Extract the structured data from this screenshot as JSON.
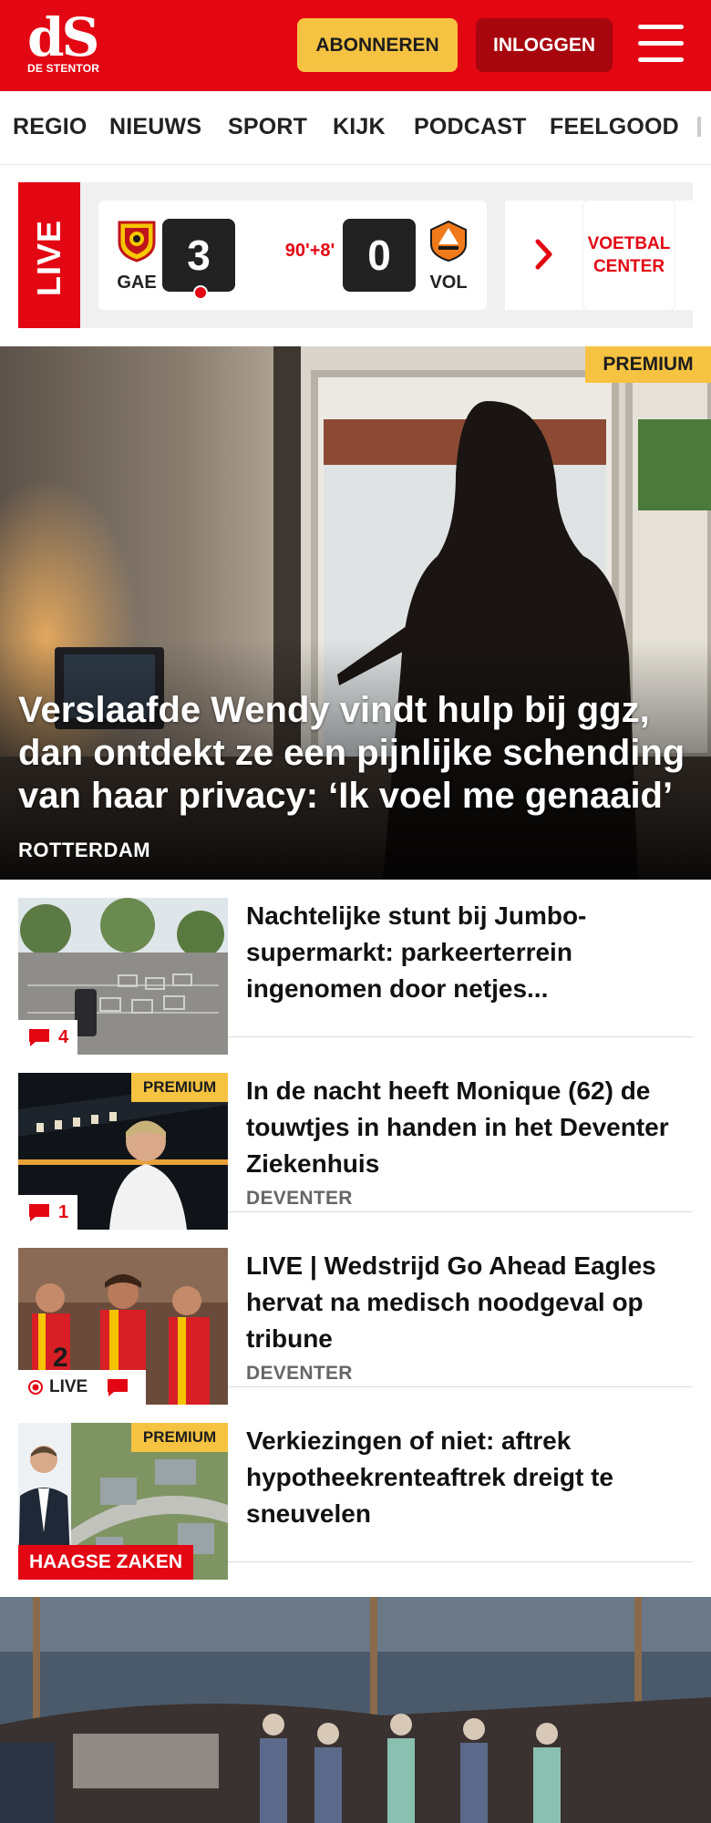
{
  "header": {
    "logo_mark": "dS",
    "logo_sub": "DE STENTOR",
    "subscribe_label": "ABONNEREN",
    "login_label": "INLOGGEN",
    "brand_color": "#e30613",
    "accent_color": "#f5c242"
  },
  "nav": {
    "items": [
      "REGIO",
      "NIEUWS",
      "SPORT",
      "KIJK",
      "PODCAST",
      "FEELGOOD"
    ]
  },
  "live": {
    "label": "LIVE",
    "home_team": "GAE",
    "home_score": "3",
    "minute": "90'+8'",
    "away_score": "0",
    "away_team": "VOL",
    "voetbal_center": "VOETBAL CENTER"
  },
  "hero": {
    "badge": "PREMIUM",
    "title": "Verslaafde Wendy vindt hulp bij ggz, dan ontdekt ze een pijnlijke schending van haar privacy: ‘Ik voel me genaaid’",
    "location": "ROTTERDAM"
  },
  "articles": [
    {
      "title": "Nachtelijke stunt bij Jumbo-supermarkt: parkeerterrein ingenomen door netjes...",
      "location": "",
      "comments": "4",
      "premium": ""
    },
    {
      "title": "In de nacht heeft Monique (62) de touwtjes in handen in het Deventer Ziekenhuis",
      "location": "DEVENTER",
      "comments": "1",
      "premium": "PREMIUM"
    },
    {
      "title": "LIVE | Wedstrijd Go Ahead Eagles hervat na medisch noodgeval op tribune",
      "location": "DEVENTER",
      "live_label": "LIVE",
      "premium": ""
    },
    {
      "title": "Verkiezingen of niet: aftrek hypotheekrenteaftrek dreigt te sneuvelen",
      "location": "",
      "tag": "HAAGSE ZAKEN",
      "premium": "PREMIUM"
    }
  ]
}
